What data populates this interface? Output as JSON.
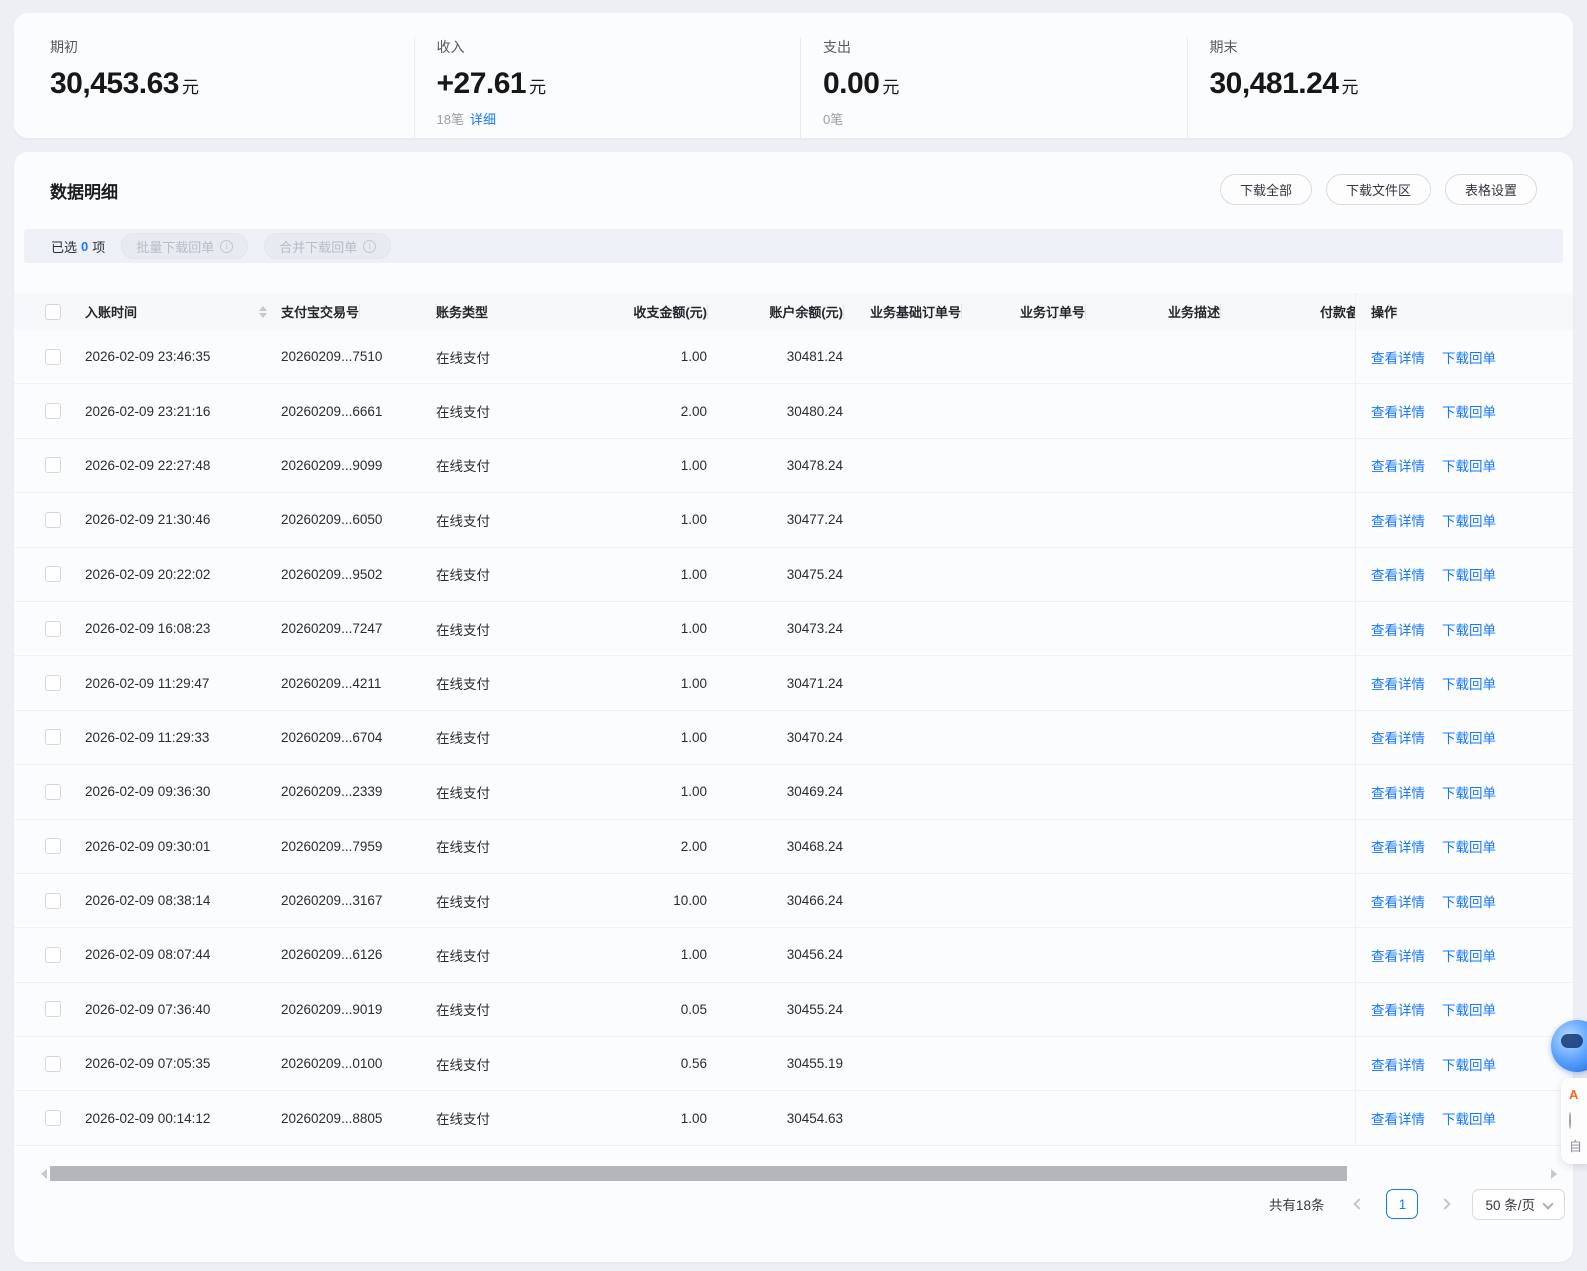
{
  "summary": {
    "items": [
      {
        "label": "期初",
        "value": "30,453.63",
        "unit": "元",
        "sub": ""
      },
      {
        "label": "收入",
        "value": "+27.61",
        "unit": "元",
        "sub": "18笔",
        "sub_link": "详细"
      },
      {
        "label": "支出",
        "value": "0.00",
        "unit": "元",
        "sub": "0笔"
      },
      {
        "label": "期末",
        "value": "30,481.24",
        "unit": "元"
      }
    ]
  },
  "panel": {
    "title": "数据明细",
    "toolbar": {
      "download_all": "下载全部",
      "download_zone": "下载文件区",
      "table_settings": "表格设置"
    },
    "selection_bar": {
      "selected_prefix": "已选",
      "selected_count": "0",
      "selected_suffix": "项",
      "batch_download": "批量下载回单",
      "merge_download": "合并下载回单"
    }
  },
  "table": {
    "columns": [
      "入账时间",
      "支付宝交易号",
      "账务类型",
      "收支金额(元)",
      "账户余额(元)",
      "业务基础订单号",
      "业务订单号",
      "业务描述",
      "付款备",
      "操作"
    ],
    "row_actions": {
      "view": "查看详情",
      "download": "下载回单"
    },
    "rows": [
      {
        "time": "2026-02-09 23:46:35",
        "txn": "20260209...7510",
        "type": "在线支付",
        "amount": "1.00",
        "balance": "30481.24"
      },
      {
        "time": "2026-02-09 23:21:16",
        "txn": "20260209...6661",
        "type": "在线支付",
        "amount": "2.00",
        "balance": "30480.24"
      },
      {
        "time": "2026-02-09 22:27:48",
        "txn": "20260209...9099",
        "type": "在线支付",
        "amount": "1.00",
        "balance": "30478.24"
      },
      {
        "time": "2026-02-09 21:30:46",
        "txn": "20260209...6050",
        "type": "在线支付",
        "amount": "1.00",
        "balance": "30477.24"
      },
      {
        "time": "2026-02-09 20:22:02",
        "txn": "20260209...9502",
        "type": "在线支付",
        "amount": "1.00",
        "balance": "30475.24"
      },
      {
        "time": "2026-02-09 16:08:23",
        "txn": "20260209...7247",
        "type": "在线支付",
        "amount": "1.00",
        "balance": "30473.24"
      },
      {
        "time": "2026-02-09 11:29:47",
        "txn": "20260209...4211",
        "type": "在线支付",
        "amount": "1.00",
        "balance": "30471.24"
      },
      {
        "time": "2026-02-09 11:29:33",
        "txn": "20260209...6704",
        "type": "在线支付",
        "amount": "1.00",
        "balance": "30470.24"
      },
      {
        "time": "2026-02-09 09:36:30",
        "txn": "20260209...2339",
        "type": "在线支付",
        "amount": "1.00",
        "balance": "30469.24"
      },
      {
        "time": "2026-02-09 09:30:01",
        "txn": "20260209...7959",
        "type": "在线支付",
        "amount": "2.00",
        "balance": "30468.24"
      },
      {
        "time": "2026-02-09 08:38:14",
        "txn": "20260209...3167",
        "type": "在线支付",
        "amount": "10.00",
        "balance": "30466.24"
      },
      {
        "time": "2026-02-09 08:07:44",
        "txn": "20260209...6126",
        "type": "在线支付",
        "amount": "1.00",
        "balance": "30456.24"
      },
      {
        "time": "2026-02-09 07:36:40",
        "txn": "20260209...9019",
        "type": "在线支付",
        "amount": "0.05",
        "balance": "30455.24"
      },
      {
        "time": "2026-02-09 07:05:35",
        "txn": "20260209...0100",
        "type": "在线支付",
        "amount": "0.56",
        "balance": "30455.19"
      },
      {
        "time": "2026-02-09 00:14:12",
        "txn": "20260209...8805",
        "type": "在线支付",
        "amount": "1.00",
        "balance": "30454.63"
      }
    ]
  },
  "pagination": {
    "total": "共有18条",
    "page": "1",
    "page_size": "50 条/页"
  },
  "colors": {
    "accent": "#1677ff",
    "page_bg": "#edeff4",
    "card_bg": "#fbfcfe"
  }
}
